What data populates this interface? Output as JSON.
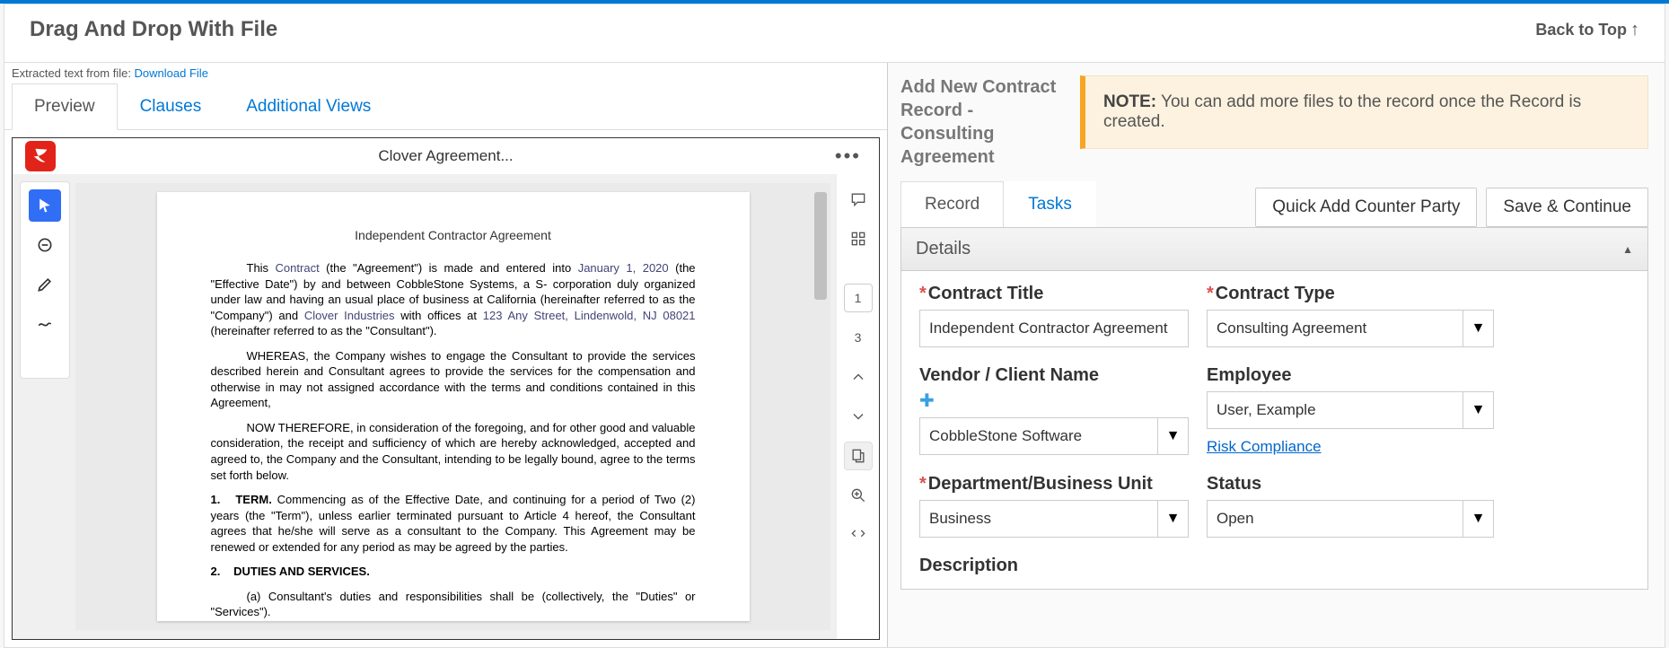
{
  "header": {
    "title": "Drag And Drop With File",
    "back": "Back to Top"
  },
  "left": {
    "extracted_prefix": "Extracted text from file: ",
    "download_label": "Download File",
    "tabs": {
      "preview": "Preview",
      "clauses": "Clauses",
      "additional": "Additional Views"
    },
    "pdf": {
      "filename": "Clover Agreement...",
      "page_current": "1",
      "page_total": "3",
      "doc_title": "Independent Contractor Agreement",
      "para1_a": "This ",
      "para1_hl1": "Contract",
      "para1_b": " (the \"Agreement\") is made and entered into ",
      "para1_hl2": "January 1, 2020",
      "para1_c": " (the \"Effective Date\") by and between CobbleStone Systems, a S- corporation duly organized under law and having an usual place of business at  California (hereinafter referred to as the \"Company\") and ",
      "para1_hl3": "Clover Industries",
      "para1_d": " with offices at ",
      "para1_hl4": "123 Any Street, Lindenwold, NJ 08021",
      "para1_e": " (hereinafter referred to as the \"Consultant\").",
      "para2": "WHEREAS, the Company wishes to engage the Consultant to provide the services described herein and Consultant agrees to provide the services for the compensation and otherwise in may not assigned accordance with the terms and conditions contained in this Agreement,",
      "para3": "NOW THEREFORE, in consideration of the foregoing, and for other good and valuable consideration, the receipt and sufficiency of which are hereby acknowledged, accepted and agreed to, the Company and the Consultant, intending to be legally bound, agree to the terms set forth below.",
      "clause1_num": "1.",
      "clause1_h": "TERM.",
      "clause1_body": "  Commencing as of the Effective Date, and continuing for a period of Two (2) years (the \"Term\"), unless earlier terminated pursuant to Article 4 hereof, the Consultant agrees that he/she will serve as a consultant to the Company.  This Agreement may be renewed or extended for any period as may be agreed by the parties.",
      "clause2_num": "2.",
      "clause2_h": "DUTIES AND SERVICES.",
      "clause2a": "(a)      Consultant's duties and responsibilities shall be (collectively, the \"Duties\" or \"Services\")."
    }
  },
  "right": {
    "add_title": "Add New Contract Record - Consulting Agreement",
    "note_strong": "NOTE:",
    "note_text": " You can add more files to the record once the Record is created.",
    "tabs": {
      "record": "Record",
      "tasks": "Tasks"
    },
    "buttons": {
      "quick_add": "Quick Add Counter Party",
      "save": "Save & Continue"
    },
    "details_header": "Details",
    "fields": {
      "contract_title": {
        "label": "Contract Title",
        "value": "Independent Contractor Agreement"
      },
      "contract_type": {
        "label": "Contract Type",
        "value": "Consulting Agreement"
      },
      "vendor": {
        "label": "Vendor / Client Name",
        "value": "CobbleStone Software"
      },
      "employee": {
        "label": "Employee",
        "value": "User, Example",
        "risk": "Risk Compliance"
      },
      "department": {
        "label": "Department/Business Unit",
        "value": "Business"
      },
      "status": {
        "label": "Status",
        "value": "Open"
      },
      "description": {
        "label": "Description"
      }
    }
  }
}
